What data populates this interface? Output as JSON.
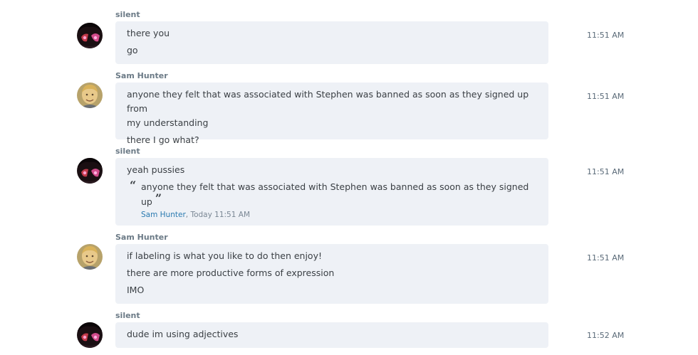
{
  "messages": [
    {
      "sender": "silent",
      "avatar": "anime-avatar",
      "time": "11:51 AM",
      "lines": [
        "there you",
        "go"
      ]
    },
    {
      "sender": "Sam Hunter",
      "avatar": "photo-avatar",
      "time": "11:51 AM",
      "lines": [
        [
          "anyone they felt that was associated with Stephen was banned as soon as they signed up from",
          "my understanding"
        ],
        "there I go what?"
      ]
    },
    {
      "sender": "silent",
      "avatar": "anime-avatar",
      "time": "11:51 AM",
      "lines": [
        "yeah pussies"
      ],
      "quote": {
        "text_line1": "anyone they felt that was associated with Stephen was banned as soon as they signed",
        "text_line2": "up",
        "author": "Sam Hunter",
        "sep": ", ",
        "stamp": "Today 11:51 AM"
      }
    },
    {
      "sender": "Sam Hunter",
      "avatar": "photo-avatar",
      "time": "11:51 AM",
      "lines": [
        "if labeling is what you like to do then enjoy!",
        "there are more productive forms of expression",
        "IMO"
      ]
    },
    {
      "sender": "silent",
      "avatar": "anime-avatar",
      "time": "11:52 AM",
      "lines": [
        "dude im using adjectives"
      ]
    }
  ],
  "quote_marks": {
    "open": "“",
    "close": "”"
  }
}
